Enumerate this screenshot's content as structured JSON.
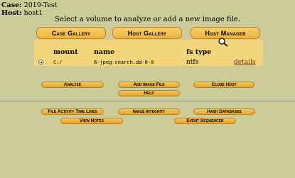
{
  "case": {
    "label": "Case:",
    "value": "2019-Test"
  },
  "host": {
    "label": "Host:",
    "value": "host1"
  },
  "instruction": "Select a volume to analyze or add a new image file.",
  "tabs": [
    "Case Gallery",
    "Host Gallery",
    "Host Manager"
  ],
  "table": {
    "headers": {
      "mount": "mount",
      "name": "name",
      "fs_type": "fs type"
    },
    "rows": [
      {
        "mount": "C:/",
        "name": "8-jpeg-search.dd-0-0",
        "fs_type": "ntfs",
        "link": "details"
      }
    ]
  },
  "buttons": {
    "analyze": "Analyze",
    "add_image_file": "Add Image File",
    "close_host": "Close Host",
    "help": "Help",
    "file_activity_time_lines": "File Activity Time Lines",
    "image_integrity": "Image Integrity",
    "hash_databases": "Hash Databases",
    "view_notes": "View Notes",
    "event_sequencer": "Event Sequencer"
  },
  "colors": {
    "background": "#cccc99",
    "tab_fill": "#f3c14f",
    "table_fill": "#f3d67c",
    "link": "#7a1b60"
  },
  "icons": {
    "cursor": "magnifier-cursor-icon"
  }
}
